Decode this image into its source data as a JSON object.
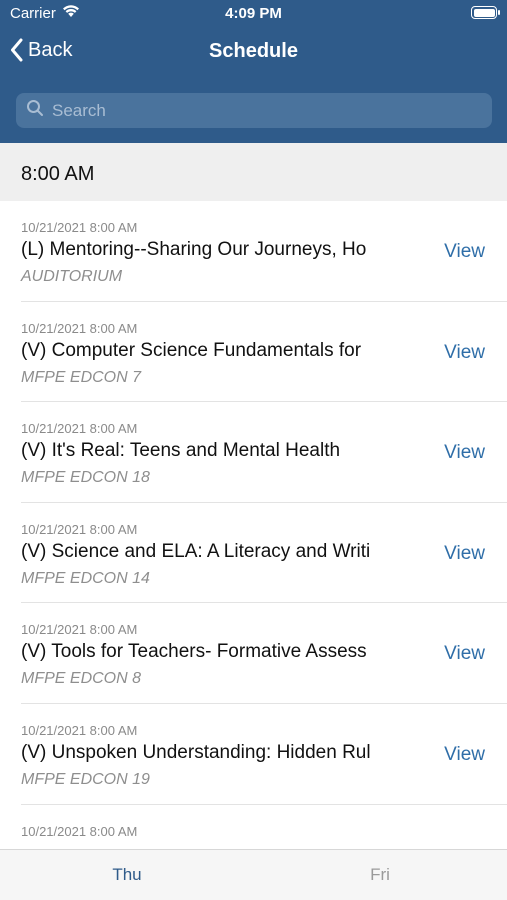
{
  "status_bar": {
    "carrier": "Carrier",
    "time": "4:09 PM"
  },
  "nav": {
    "back_label": "Back",
    "title": "Schedule"
  },
  "search": {
    "placeholder": "Search"
  },
  "section": {
    "time_header": "8:00 AM"
  },
  "sessions": [
    {
      "date": "10/21/2021 8:00 AM",
      "title": "(L) Mentoring--Sharing Our Journeys, Ho",
      "location": "AUDITORIUM",
      "action": "View"
    },
    {
      "date": "10/21/2021 8:00 AM",
      "title": "(V) Computer Science Fundamentals for",
      "location": "MFPE EDCON 7",
      "action": "View"
    },
    {
      "date": "10/21/2021 8:00 AM",
      "title": "(V) It's Real: Teens and Mental Health",
      "location": "MFPE EDCON 18",
      "action": "View"
    },
    {
      "date": "10/21/2021 8:00 AM",
      "title": "(V) Science and ELA: A Literacy and Writi",
      "location": "MFPE EDCON 14",
      "action": "View"
    },
    {
      "date": "10/21/2021 8:00 AM",
      "title": "(V) Tools for Teachers- Formative Assess",
      "location": "MFPE EDCON 8",
      "action": "View"
    },
    {
      "date": "10/21/2021 8:00 AM",
      "title": "(V) Unspoken Understanding: Hidden Rul",
      "location": "MFPE EDCON 19",
      "action": "View"
    },
    {
      "date": "10/21/2021 8:00 AM",
      "title": "",
      "location": "",
      "action": ""
    }
  ],
  "tabs": [
    {
      "label": "Thu",
      "selected": true
    },
    {
      "label": "Fri",
      "selected": false
    }
  ],
  "colors": {
    "header_bg": "#2f5b8a",
    "accent": "#2f6ea8"
  }
}
